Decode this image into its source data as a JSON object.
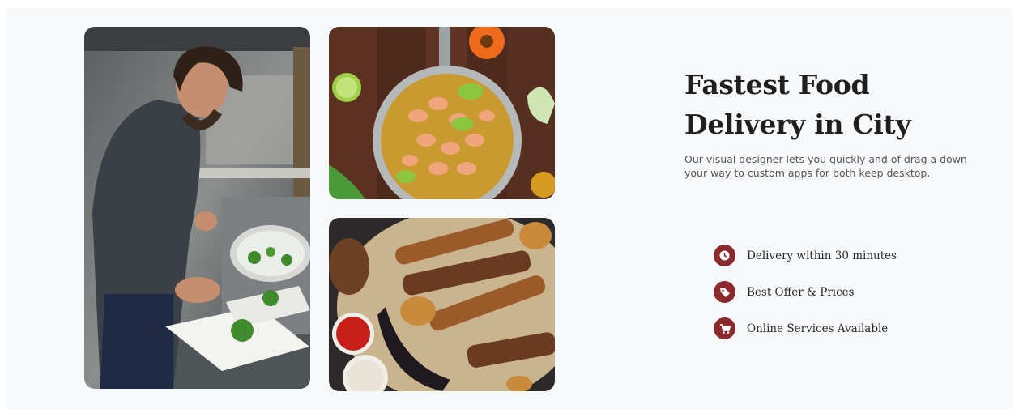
{
  "gallery": {
    "images": [
      {
        "alt": "Chef plating chopped herbs in a restaurant kitchen"
      },
      {
        "alt": "Pan of shrimp curry with lime and herbs"
      },
      {
        "alt": "Grilled kebabs with potatoes and sauces"
      }
    ]
  },
  "hero": {
    "title_line1": "Fastest Food",
    "title_line2": "Delivery in City",
    "description": "Our visual designer lets you quickly and of drag a down your way to custom apps for both keep desktop."
  },
  "features": [
    {
      "label": "Delivery within 30 minutes",
      "icon": "clock-icon"
    },
    {
      "label": "Best Offer & Prices",
      "icon": "tag-icon"
    },
    {
      "label": "Online Services Available",
      "icon": "cart-icon"
    }
  ],
  "colors": {
    "accent": "#8b2a2c",
    "section_bg": "#f7f8fa",
    "heading": "#1f1f1f"
  }
}
